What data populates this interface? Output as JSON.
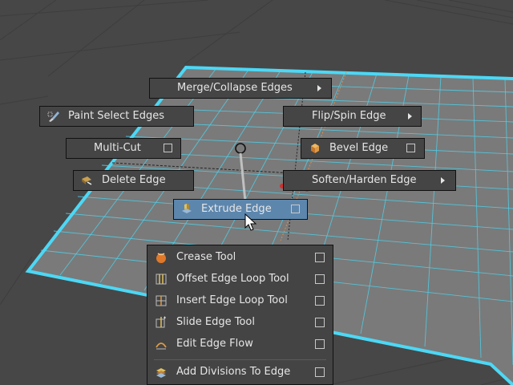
{
  "marking_menu": {
    "items": {
      "merge_collapse": "Merge/Collapse Edges",
      "paint_select": "Paint Select Edges",
      "flip_spin": "Flip/Spin Edge",
      "multi_cut": "Multi-Cut",
      "bevel": "Bevel Edge",
      "delete_edge": "Delete Edge",
      "soften_harden": "Soften/Harden Edge",
      "extrude_edge": "Extrude Edge"
    },
    "highlighted_item": "Extrude Edge"
  },
  "submenu": {
    "items": [
      {
        "label": "Crease Tool",
        "icon": "crease-icon"
      },
      {
        "label": "Offset Edge Loop Tool",
        "icon": "offset-edge-loop-icon"
      },
      {
        "label": "Insert Edge Loop Tool",
        "icon": "insert-edge-loop-icon"
      },
      {
        "label": "Slide Edge Tool",
        "icon": "slide-edge-icon"
      },
      {
        "label": "Edit Edge Flow",
        "icon": "edit-edge-flow-icon"
      },
      {
        "label": "Add Divisions To Edge",
        "icon": "add-divisions-icon"
      }
    ]
  },
  "colors": {
    "viewport_bg": "#474747",
    "plane_fill": "#7a7a7a",
    "selected_edges": "#4cd8f5",
    "highlight": "#5d86ad"
  }
}
